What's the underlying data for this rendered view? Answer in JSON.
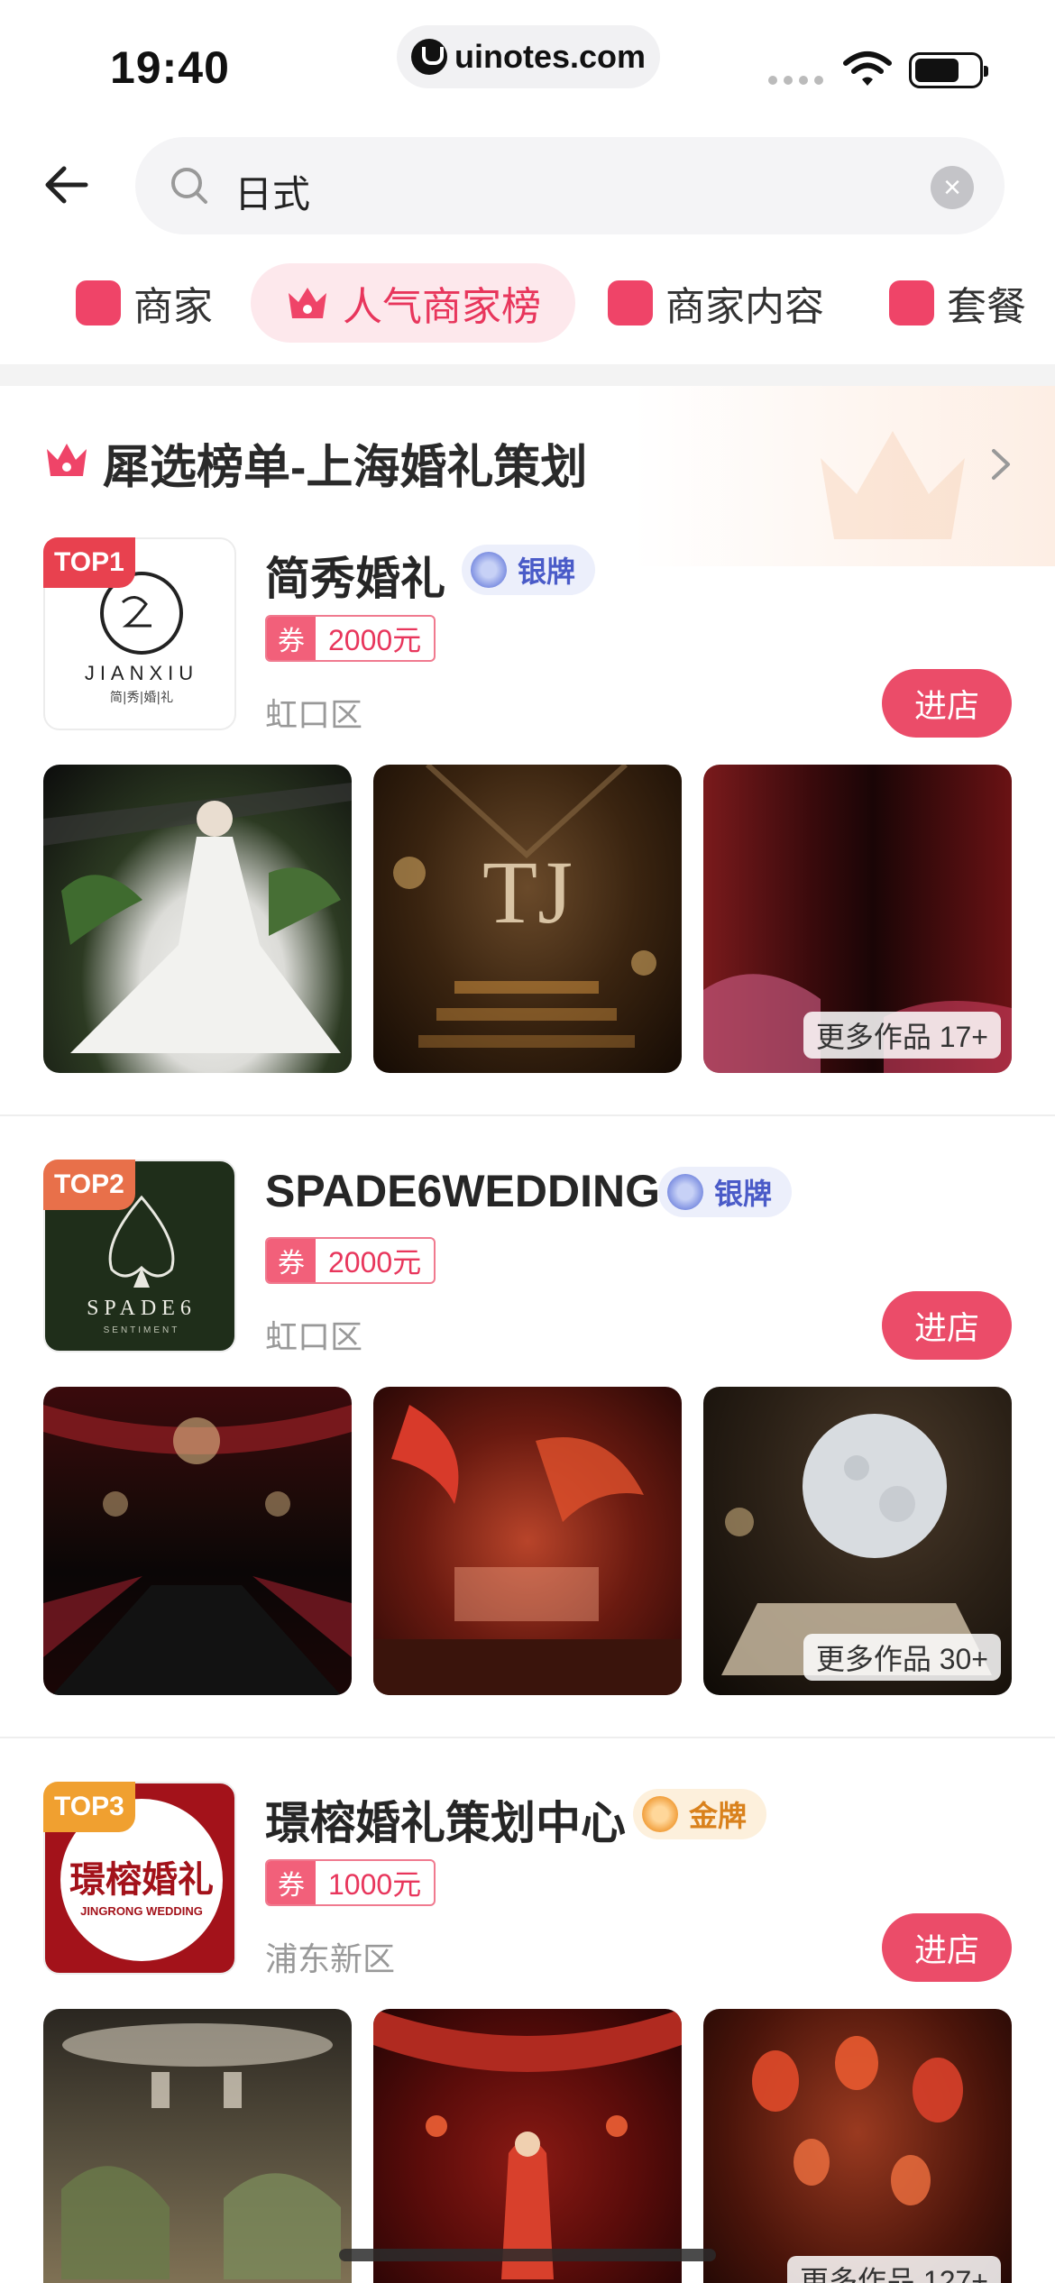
{
  "status_bar": {
    "time": "19:40",
    "url": "uinotes.com"
  },
  "search": {
    "value": "日式"
  },
  "tabs": [
    {
      "label": "商家"
    },
    {
      "label": "人气商家榜"
    },
    {
      "label": "商家内容"
    },
    {
      "label": "套餐"
    }
  ],
  "section": {
    "title": "犀选榜单-上海婚礼策划"
  },
  "colors": {
    "accent": "#eb4c69",
    "silver_text": "#4a5bc8",
    "gold_text": "#d9811c"
  },
  "merchants": [
    {
      "rank": "TOP1",
      "name": "简秀婚礼",
      "medal": "银牌",
      "medal_type": "silver",
      "coupon_tag": "券",
      "coupon_amount": "2000元",
      "district": "虹口区",
      "enter_label": "进店",
      "more_works": "更多作品 17+",
      "logo_text": "JIANXIU",
      "logo_subtext": "简|秀|婚|礼"
    },
    {
      "rank": "TOP2",
      "name": "SPADE6WEDDING",
      "medal": "银牌",
      "medal_type": "silver",
      "coupon_tag": "券",
      "coupon_amount": "2000元",
      "district": "虹口区",
      "enter_label": "进店",
      "more_works": "更多作品 30+",
      "logo_text": "SPADE6",
      "logo_subtext": "SENTIMENT"
    },
    {
      "rank": "TOP3",
      "name": "璟榕婚礼策划中心",
      "medal": "金牌",
      "medal_type": "gold",
      "coupon_tag": "券",
      "coupon_amount": "1000元",
      "district": "浦东新区",
      "enter_label": "进店",
      "more_works": "更多作品 127+",
      "logo_text": "璟榕婚礼",
      "logo_subtext": "JINGRONG WEDDING"
    }
  ]
}
